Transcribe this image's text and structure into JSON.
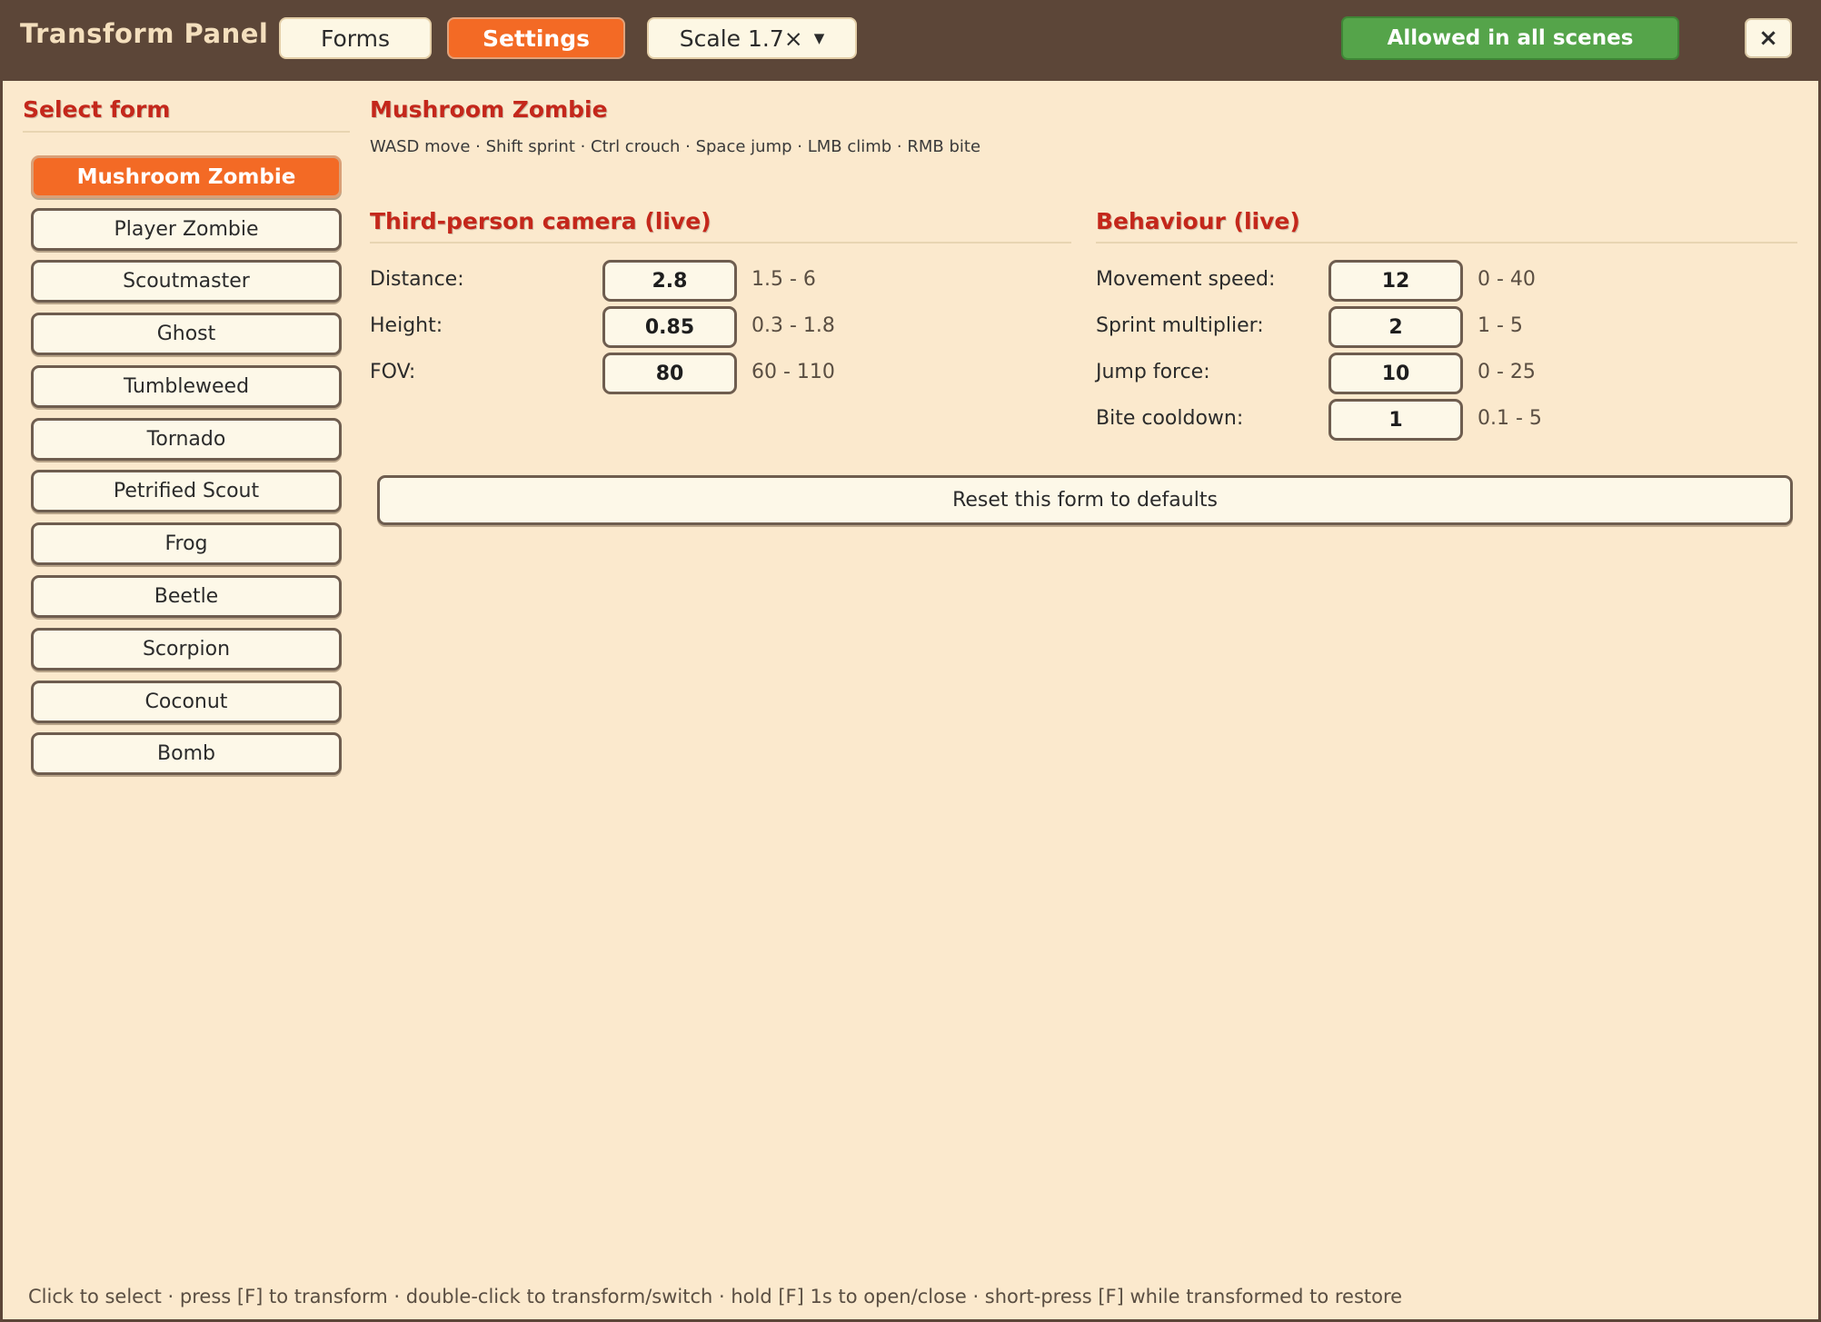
{
  "app": {
    "title": "Transform Panel"
  },
  "tabs": [
    {
      "label": "Forms",
      "active": false
    },
    {
      "label": "Settings",
      "active": true
    }
  ],
  "scale": {
    "label": "Scale 1.7×",
    "caret_icon": "caret-down-icon"
  },
  "status_badge": {
    "label": "Allowed in all scenes",
    "color": "#55a44a"
  },
  "close": {
    "label": "×"
  },
  "sidebar": {
    "title": "Select form",
    "forms": [
      {
        "label": "Mushroom Zombie",
        "selected": true
      },
      {
        "label": "Player Zombie"
      },
      {
        "label": "Scoutmaster"
      },
      {
        "label": "Ghost"
      },
      {
        "label": "Tumbleweed"
      },
      {
        "label": "Tornado"
      },
      {
        "label": "Petrified Scout"
      },
      {
        "label": "Frog"
      },
      {
        "label": "Beetle"
      },
      {
        "label": "Scorpion"
      },
      {
        "label": "Coconut"
      },
      {
        "label": "Bomb"
      }
    ]
  },
  "main": {
    "title": "Mushroom Zombie",
    "controls": "WASD move · Shift sprint · Ctrl crouch · Space jump · LMB climb · RMB bite",
    "camera": {
      "title": "Third-person camera (live)",
      "params": [
        {
          "label": "Distance:",
          "value": "2.8",
          "range": "1.5 - 6"
        },
        {
          "label": "Height:",
          "value": "0.85",
          "range": "0.3 - 1.8"
        },
        {
          "label": "FOV:",
          "value": "80",
          "range": "60 - 110"
        }
      ]
    },
    "behaviour": {
      "title": "Behaviour (live)",
      "params": [
        {
          "label": "Movement speed:",
          "value": "12",
          "range": "0 - 40"
        },
        {
          "label": "Sprint multiplier:",
          "value": "2",
          "range": "1 - 5"
        },
        {
          "label": "Jump force:",
          "value": "10",
          "range": "0 - 25"
        },
        {
          "label": "Bite cooldown:",
          "value": "1",
          "range": "0.1 - 5"
        }
      ]
    },
    "reset_label": "Reset this form to defaults"
  },
  "footer": {
    "hint": "Click to select · press [F] to transform · double-click to transform/switch · hold [F] 1s to open/close · short-press [F] while transformed to restore"
  },
  "colors": {
    "accent": "#f36a25",
    "heading": "#c4271b",
    "panel_bg": "#fbe9cd",
    "frame": "#5c4638"
  }
}
